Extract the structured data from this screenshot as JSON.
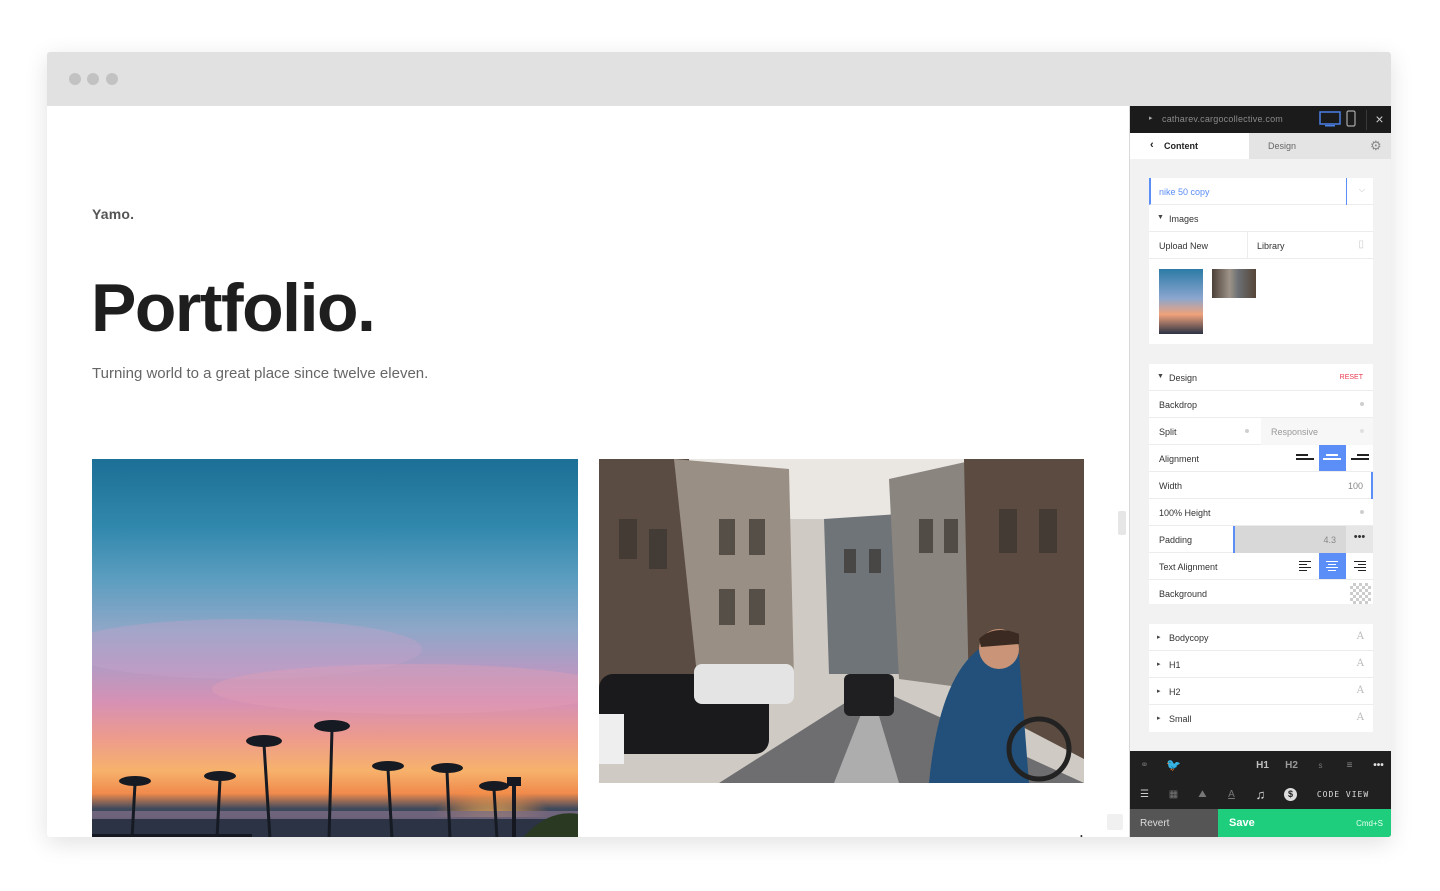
{
  "site": {
    "brand": "Yamo.",
    "title": "Portfolio.",
    "subtitle": "Turning world to a great place since twelve eleven."
  },
  "panel": {
    "url": "catharev.cargocollective.com",
    "tabs": {
      "content": "Content",
      "design": "Design"
    },
    "page_name": "nike 50 copy",
    "images": {
      "header": "Images",
      "upload_new": "Upload New",
      "library": "Library"
    },
    "design": {
      "header": "Design",
      "reset": "RESET",
      "backdrop": "Backdrop",
      "split": "Split",
      "responsive": "Responsive",
      "alignment": "Alignment",
      "width": "Width",
      "width_value": "100",
      "full_height": "100% Height",
      "padding": "Padding",
      "padding_value": "4.3",
      "text_alignment": "Text Alignment",
      "background": "Background"
    },
    "typography": {
      "items": [
        "Bodycopy",
        "H1",
        "H2",
        "Small"
      ]
    },
    "toolbar": {
      "h1": "H1",
      "h2": "H2",
      "s": "s",
      "code_view": "CODE VIEW"
    },
    "actions": {
      "revert": "Revert",
      "save": "Save",
      "save_shortcut": "Cmd+S"
    }
  },
  "colors": {
    "accent_blue": "#5b8ef7",
    "save_green": "#1fce7c",
    "reset_red": "#e8384f"
  }
}
